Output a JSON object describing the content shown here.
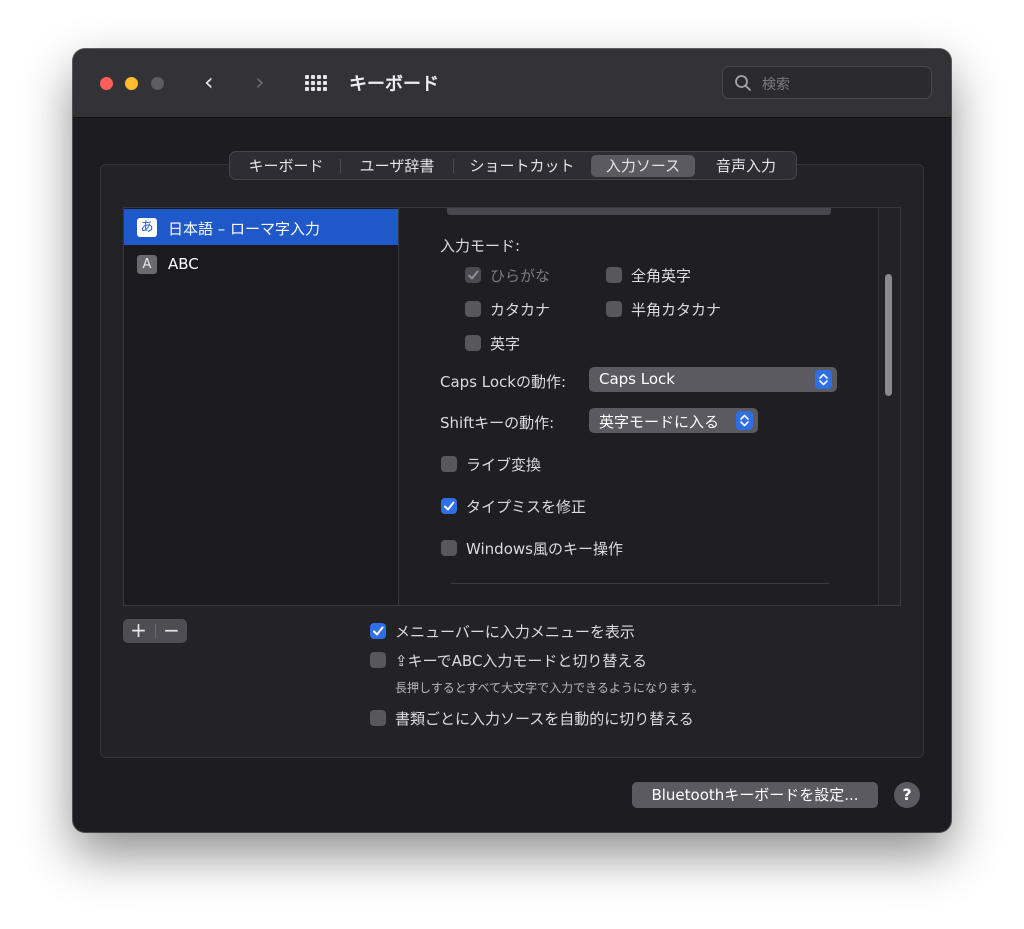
{
  "window": {
    "title": "キーボード",
    "search_placeholder": "検索"
  },
  "tabs": [
    {
      "label": "キーボード",
      "active": false
    },
    {
      "label": "ユーザ辞書",
      "active": false
    },
    {
      "label": "ショートカット",
      "active": false
    },
    {
      "label": "入力ソース",
      "active": true
    },
    {
      "label": "音声入力",
      "active": false
    }
  ],
  "sources": [
    {
      "badge": "あ",
      "label": "日本語 – ローマ字入力",
      "selected": true
    },
    {
      "badge": "A",
      "label": "ABC",
      "selected": false
    }
  ],
  "input_mode": {
    "heading": "入力モード:",
    "hiragana": {
      "label": "ひらがな",
      "checked": true,
      "disabled": true
    },
    "zenkaku_eiji": {
      "label": "全角英字",
      "checked": false
    },
    "katakana": {
      "label": "カタカナ",
      "checked": false
    },
    "hankaku_katakana": {
      "label": "半角カタカナ",
      "checked": false
    },
    "eiji": {
      "label": "英字",
      "checked": false
    }
  },
  "caps_lock": {
    "label": "Caps Lockの動作:",
    "value": "Caps Lock"
  },
  "shift": {
    "label": "Shiftキーの動作:",
    "value": "英字モードに入る"
  },
  "options": {
    "live_conversion": {
      "label": "ライブ変換",
      "checked": false
    },
    "typo_correction": {
      "label": "タイプミスを修正",
      "checked": true
    },
    "windows_keys": {
      "label": "Windows風のキー操作",
      "checked": false
    }
  },
  "list_controls": {
    "add": "+",
    "remove": "−"
  },
  "bottom": {
    "show_menu": {
      "label": "メニューバーに入力メニューを表示",
      "checked": true
    },
    "shift_abc": {
      "label": "⇪キーでABC入力モードと切り替える",
      "checked": false
    },
    "shift_abc_hint": "長押しするとすべて大文字で入力できるようになります。",
    "auto_switch": {
      "label": "書類ごとに入力ソースを自動的に切り替える",
      "checked": false
    }
  },
  "buttons": {
    "bluetooth": "Bluetoothキーボードを設定...",
    "help": "?"
  },
  "colors": {
    "accent": "#2f6fe4",
    "selection": "#1f58c9",
    "window_bg": "#1d1c21",
    "titlebar_bg": "#333236"
  }
}
